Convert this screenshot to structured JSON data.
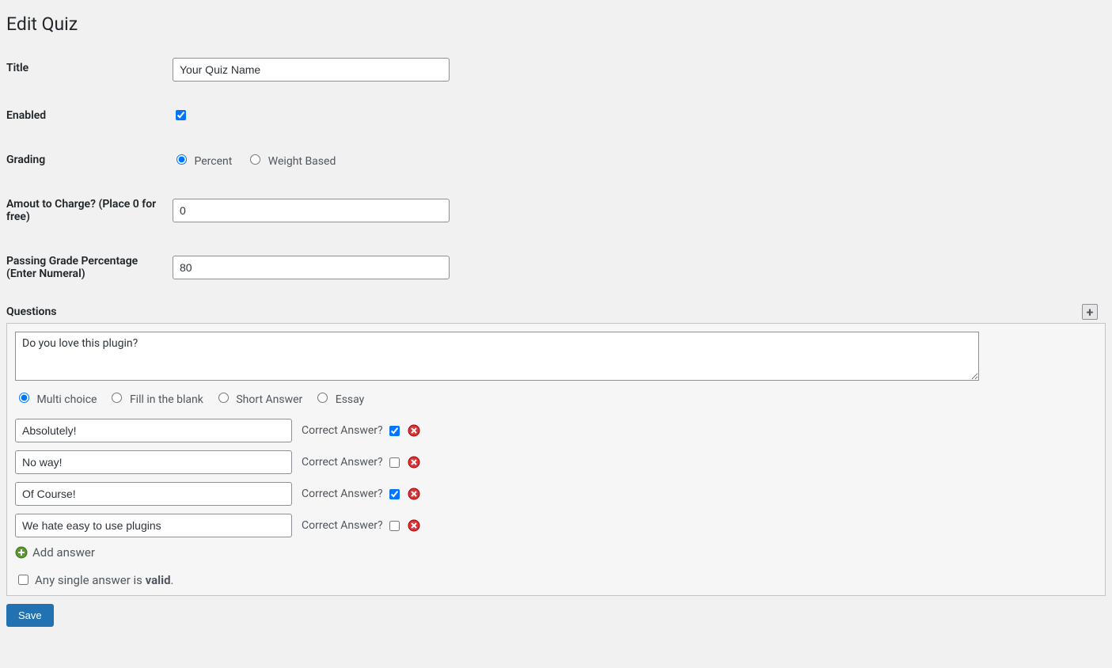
{
  "page": {
    "title": "Edit Quiz"
  },
  "fields": {
    "title_label": "Title",
    "title_value": "Your Quiz Name",
    "enabled_label": "Enabled",
    "enabled_checked": true,
    "grading_label": "Grading",
    "grading_options": [
      "Percent",
      "Weight Based"
    ],
    "grading_selected": "Percent",
    "amount_label": "Amout to Charge? (Place 0 for free)",
    "amount_value": "0",
    "passing_label": "Passing Grade Percentage (Enter Numeral)",
    "passing_value": "80"
  },
  "questions_header": {
    "label": "Questions",
    "add_icon": "plus-icon"
  },
  "question": {
    "text": "Do you love this plugin?",
    "types": [
      "Multi choice",
      "Fill in the blank",
      "Short Answer",
      "Essay"
    ],
    "type_selected": "Multi choice",
    "correct_label": "Correct Answer?",
    "answers": [
      {
        "text": "Absolutely!",
        "correct": true
      },
      {
        "text": "No way!",
        "correct": false
      },
      {
        "text": "Of Course!",
        "correct": true
      },
      {
        "text": "We hate easy to use plugins",
        "correct": false
      }
    ],
    "add_answer_label": "Add answer",
    "any_valid_prefix": "Any single answer is ",
    "any_valid_bold": "valid",
    "any_valid_suffix": ".",
    "any_valid_checked": false
  },
  "actions": {
    "save_label": "Save"
  },
  "icons": {
    "delete": "delete-icon",
    "add_green": "add-green-icon"
  }
}
